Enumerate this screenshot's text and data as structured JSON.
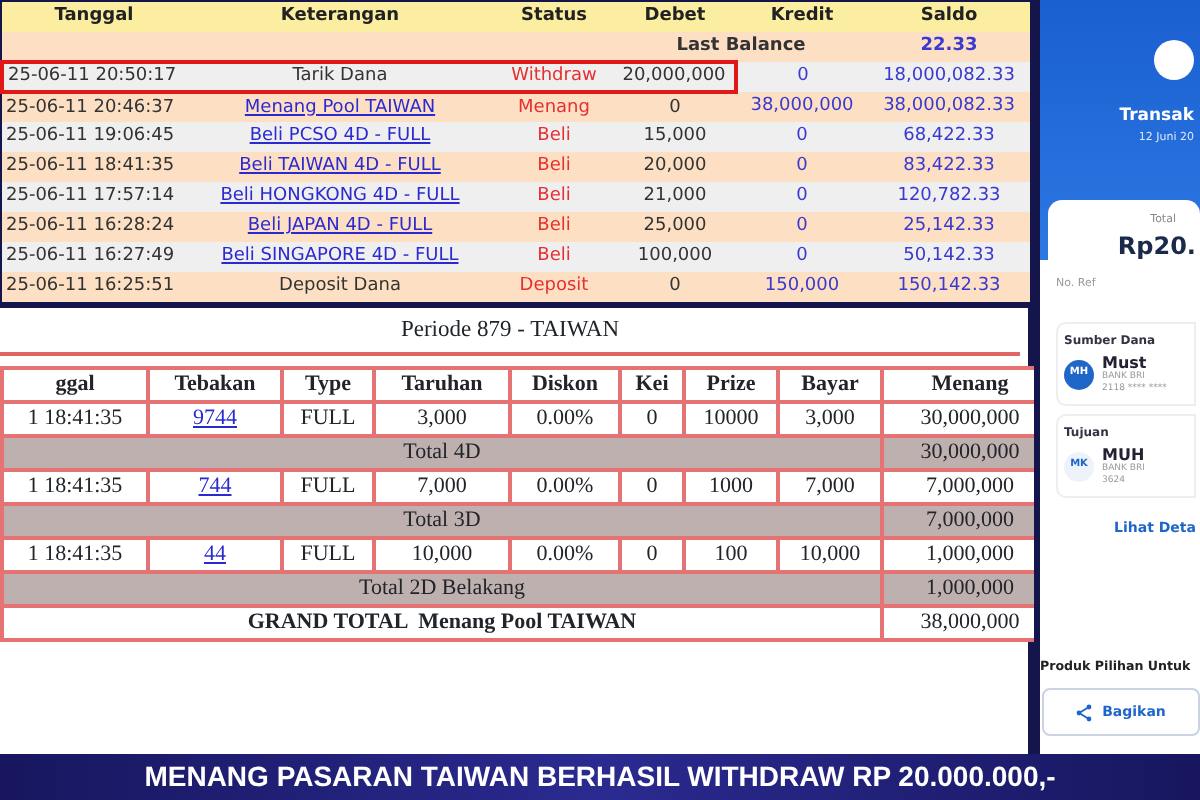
{
  "transactions": {
    "columns": [
      "Tanggal",
      "Keterangan",
      "Status",
      "Debet",
      "Kredit",
      "Saldo"
    ],
    "last_balance": {
      "label": "Last Balance",
      "value": "22.33"
    },
    "rows": [
      {
        "date": "25-06-11 20:50:17",
        "description": "Tarik Dana",
        "kind": "text",
        "status": "Withdraw",
        "debet": "20,000,000",
        "kredit": "0",
        "saldo": "18,000,082.33",
        "highlighted": true
      },
      {
        "date": "25-06-11 20:46:37",
        "description": "Menang Pool TAIWAN",
        "kind": "link",
        "status": "Menang",
        "debet": "0",
        "kredit": "38,000,000",
        "saldo": "38,000,082.33",
        "highlighted": false
      },
      {
        "date": "25-06-11 19:06:45",
        "description": "Beli PCSO 4D - FULL",
        "kind": "link",
        "status": "Beli",
        "debet": "15,000",
        "kredit": "0",
        "saldo": "68,422.33",
        "highlighted": false
      },
      {
        "date": "25-06-11 18:41:35",
        "description": "Beli TAIWAN 4D - FULL",
        "kind": "link",
        "status": "Beli",
        "debet": "20,000",
        "kredit": "0",
        "saldo": "83,422.33",
        "highlighted": false
      },
      {
        "date": "25-06-11 17:57:14",
        "description": "Beli HONGKONG 4D - FULL",
        "kind": "link",
        "status": "Beli",
        "debet": "21,000",
        "kredit": "0",
        "saldo": "120,782.33",
        "highlighted": false
      },
      {
        "date": "25-06-11 16:28:24",
        "description": "Beli JAPAN 4D - FULL",
        "kind": "link",
        "status": "Beli",
        "debet": "25,000",
        "kredit": "0",
        "saldo": "25,142.33",
        "highlighted": false
      },
      {
        "date": "25-06-11 16:27:49",
        "description": "Beli SINGAPORE 4D - FULL",
        "kind": "link",
        "status": "Beli",
        "debet": "100,000",
        "kredit": "0",
        "saldo": "50,142.33",
        "highlighted": false
      },
      {
        "date": "25-06-11 16:25:51",
        "description": "Deposit Dana",
        "kind": "text",
        "status": "Deposit",
        "debet": "0",
        "kredit": "150,000",
        "saldo": "150,142.33",
        "highlighted": false
      }
    ]
  },
  "bet_detail": {
    "period": "Periode 879 - TAIWAN",
    "columns": [
      "ggal",
      "Tebakan",
      "Type",
      "Taruhan",
      "Diskon",
      "Kei",
      "Prize",
      "Bayar",
      "Menang"
    ],
    "groups": [
      {
        "row": [
          "1 18:41:35",
          "9744",
          "FULL",
          "3,000",
          "0.00%",
          "0",
          "10000",
          "3,000",
          "30,000,000"
        ],
        "total_label": "Total 4D",
        "total_value": "30,000,000"
      },
      {
        "row": [
          "1 18:41:35",
          "744",
          "FULL",
          "7,000",
          "0.00%",
          "0",
          "1000",
          "7,000",
          "7,000,000"
        ],
        "total_label": "Total 3D",
        "total_value": "7,000,000"
      },
      {
        "row": [
          "1 18:41:35",
          "44",
          "FULL",
          "10,000",
          "0.00%",
          "0",
          "100",
          "10,000",
          "1,000,000"
        ],
        "total_label": "Total 2D Belakang",
        "total_value": "1,000,000"
      }
    ],
    "grand_total": {
      "label": "GRAND TOTAL  Menang Pool TAIWAN",
      "value": "38,000,000"
    }
  },
  "receipt": {
    "title": "Transak",
    "date": "12 Juni 20",
    "total_label": "Total",
    "amount": "Rp20.",
    "ref_label": "No. Ref",
    "parties": [
      {
        "heading": "Sumber Dana",
        "initials": "MH",
        "color": "#1f66c9",
        "name": "Must",
        "bank": "BANK BRI",
        "account": "2118 **** ****"
      },
      {
        "heading": "Tujuan",
        "initials": "MK",
        "color": "#eef3fa",
        "name": "MUH",
        "bank": "BANK BRI",
        "account": "3624"
      }
    ],
    "detail_link": "Lihat Deta",
    "products_heading": "Produk Pilihan Untuk",
    "share_button": "Bagikan"
  },
  "banner": "MENANG PASARAN TAIWAN BERHASIL WITHDRAW RP 20.000.000,-"
}
